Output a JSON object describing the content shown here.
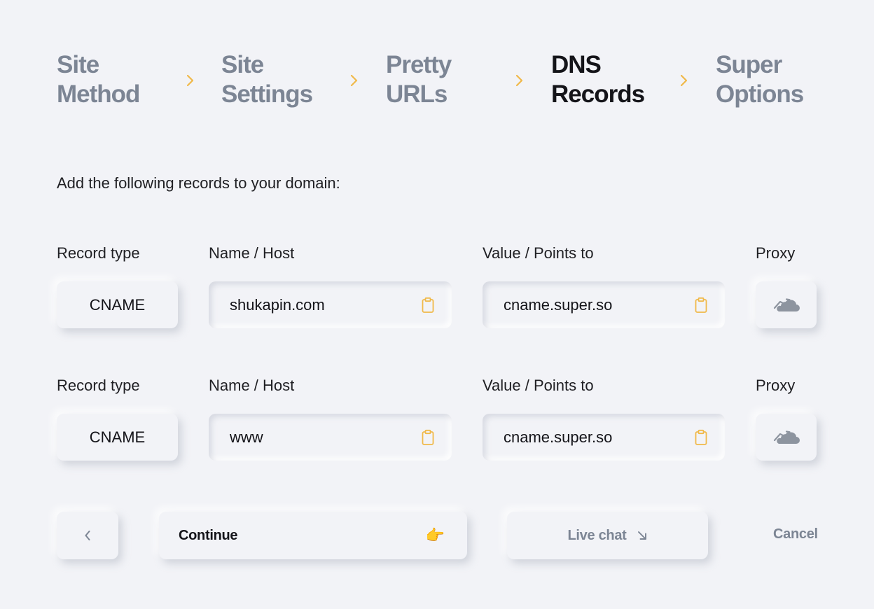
{
  "stepper": {
    "steps": [
      {
        "label": "Site\nMethod",
        "active": false
      },
      {
        "label": "Site\nSettings",
        "active": false
      },
      {
        "label": "Pretty\nURLs",
        "active": false
      },
      {
        "label": "DNS\nRecords",
        "active": true
      },
      {
        "label": "Super\nOptions",
        "active": false
      }
    ],
    "separator_icon": "chevron-right-icon"
  },
  "instruction": "Add the following records to your domain:",
  "columns": {
    "record_type": "Record type",
    "name_host": "Name / Host",
    "value": "Value / Points to",
    "proxy": "Proxy"
  },
  "records": [
    {
      "type": "CNAME",
      "name": "shukapin.com",
      "value": "cname.super.so",
      "proxy_icon": "cloud-icon"
    },
    {
      "type": "CNAME",
      "name": "www",
      "value": "cname.super.so",
      "proxy_icon": "cloud-icon"
    }
  ],
  "footer": {
    "back_icon": "chevron-left-icon",
    "continue_label": "Continue",
    "continue_emoji": "👉",
    "live_chat_label": "Live chat",
    "live_chat_icon": "arrow-down-right-icon",
    "cancel_label": "Cancel"
  },
  "colors": {
    "background": "#f2f3f7",
    "accent": "#f0b94a",
    "muted": "#7c8594",
    "text": "#141419"
  }
}
